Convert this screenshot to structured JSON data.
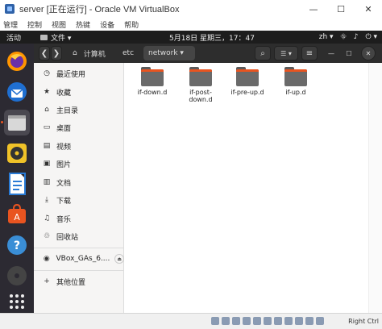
{
  "window": {
    "title": "server [正在运行] - Oracle VM VirtualBox",
    "minimize_glyph": "—",
    "maximize_glyph": "☐",
    "close_glyph": "✕"
  },
  "vbox_menu": [
    "管理",
    "控制",
    "视图",
    "热键",
    "设备",
    "帮助"
  ],
  "topbar": {
    "activities": "活动",
    "app_name": "文件 ▾",
    "clock": "5月18日 星期三，17：47",
    "lang": "zh ▾",
    "network_glyph": "⛗",
    "volume_glyph": "♪",
    "power_glyph": "⏻ ▾"
  },
  "dock": {
    "items": [
      "firefox-icon",
      "thunderbird-icon",
      "files-icon",
      "rhythmbox-icon",
      "writer-icon",
      "software-icon",
      "help-icon",
      "dvd-icon"
    ],
    "apps_icon": "show-applications-icon"
  },
  "header": {
    "back_glyph": "❮",
    "forward_glyph": "❯",
    "home_glyph": "⌂",
    "breadcrumbs": [
      "计算机",
      "etc",
      "network ▾"
    ],
    "search_glyph": "⌕",
    "view_glyph": "☰ ▾",
    "menu_glyph": "≡",
    "min_glyph": "—",
    "max_glyph": "☐",
    "close_glyph": "✕"
  },
  "sidebar": {
    "items": [
      {
        "icon": "◷",
        "label": "最近使用"
      },
      {
        "icon": "★",
        "label": "收藏"
      },
      {
        "icon": "⌂",
        "label": "主目录"
      },
      {
        "icon": "▭",
        "label": "桌面"
      },
      {
        "icon": "▤",
        "label": "视频"
      },
      {
        "icon": "▣",
        "label": "图片"
      },
      {
        "icon": "▥",
        "label": "文档"
      },
      {
        "icon": "⤓",
        "label": "下载"
      },
      {
        "icon": "♫",
        "label": "音乐"
      },
      {
        "icon": "♲",
        "label": "回收站"
      }
    ],
    "device": {
      "icon": "◉",
      "label": "VBox_GAs_6....",
      "eject": "⏏"
    },
    "other": {
      "icon": "+",
      "label": "其他位置"
    }
  },
  "files": [
    {
      "name": "if-down.d"
    },
    {
      "name": "if-post-down.d"
    },
    {
      "name": "if-pre-up.d"
    },
    {
      "name": "if-up.d"
    }
  ],
  "statusbar": {
    "host_key": "Right Ctrl"
  }
}
